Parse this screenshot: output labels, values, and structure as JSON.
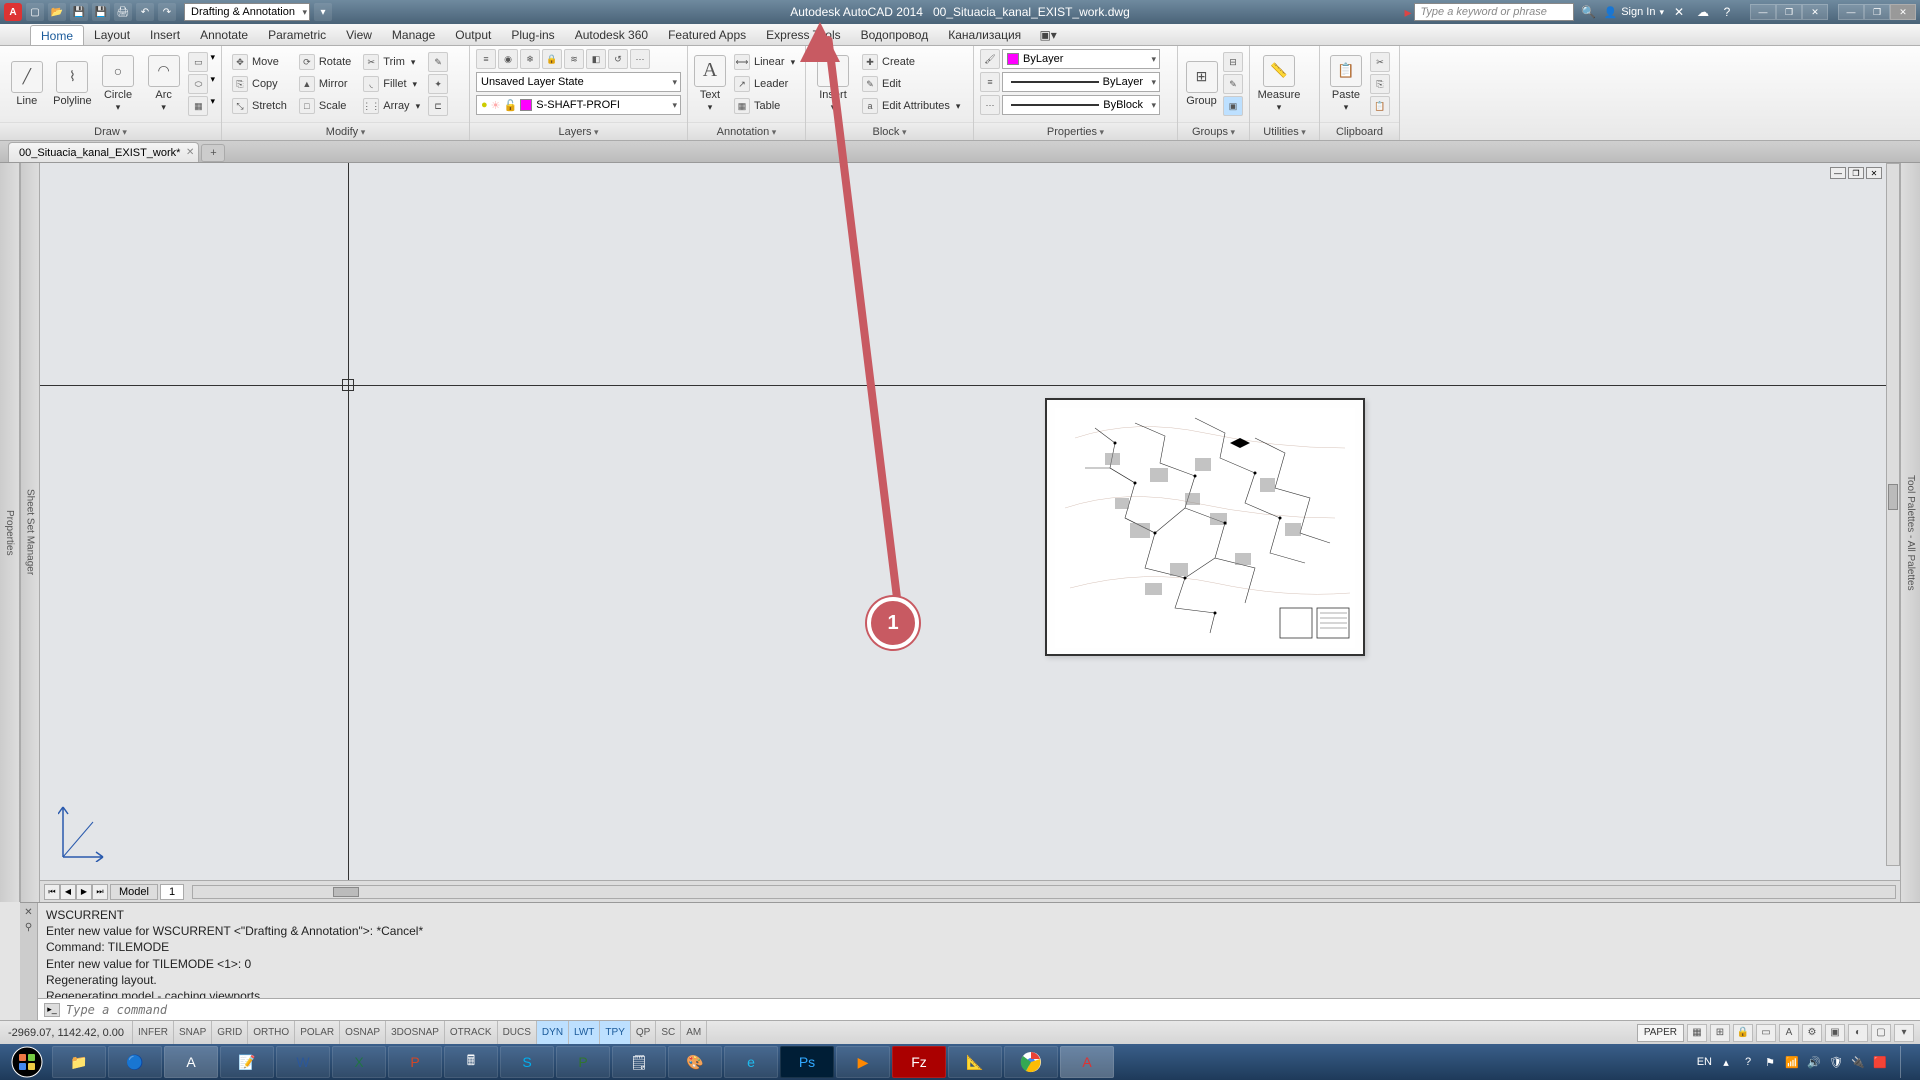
{
  "title": {
    "app": "Autodesk AutoCAD 2014",
    "doc": "00_Situacia_kanal_EXIST_work.dwg"
  },
  "qat": {
    "workspace": "Drafting & Annotation"
  },
  "search": {
    "placeholder": "Type a keyword or phrase"
  },
  "signin": "Sign In",
  "menus": [
    "Home",
    "Layout",
    "Insert",
    "Annotate",
    "Parametric",
    "View",
    "Manage",
    "Output",
    "Plug-ins",
    "Autodesk 360",
    "Featured Apps",
    "Express Tools",
    "Водопровод",
    "Канализация"
  ],
  "ribbon": {
    "draw": {
      "title": "Draw",
      "line": "Line",
      "polyline": "Polyline",
      "circle": "Circle",
      "arc": "Arc"
    },
    "modify": {
      "title": "Modify",
      "move": "Move",
      "rotate": "Rotate",
      "trim": "Trim",
      "copy": "Copy",
      "mirror": "Mirror",
      "fillet": "Fillet",
      "stretch": "Stretch",
      "scale": "Scale",
      "array": "Array"
    },
    "layers": {
      "title": "Layers",
      "state": "Unsaved Layer State",
      "current": "S-SHAFT-PROFI"
    },
    "annotation": {
      "title": "Annotation",
      "text": "Text",
      "linear": "Linear",
      "leader": "Leader",
      "table": "Table"
    },
    "block": {
      "title": "Block",
      "insert": "Insert",
      "create": "Create",
      "edit": "Edit",
      "editattr": "Edit Attributes"
    },
    "properties": {
      "title": "Properties",
      "color": "ByLayer",
      "lw": "ByLayer",
      "lt": "ByBlock"
    },
    "groups": {
      "title": "Groups",
      "group": "Group"
    },
    "utilities": {
      "title": "Utilities",
      "measure": "Measure"
    },
    "clipboard": {
      "title": "Clipboard",
      "paste": "Paste"
    }
  },
  "doctab": {
    "name": "00_Situacia_kanal_EXIST_work*"
  },
  "layout": {
    "model": "Model",
    "l1": "1"
  },
  "cmd": {
    "l1": "WSCURRENT",
    "l2": "Enter new value for WSCURRENT <\"Drafting & Annotation\">: *Cancel*",
    "l3": "Command: TILEMODE",
    "l4": "Enter new value for TILEMODE <1>: 0",
    "l5": "Regenerating layout.",
    "l6": "Regenerating model - caching viewports.",
    "placeholder": "Type a command"
  },
  "status": {
    "coords": "-2969.07, 1142.42, 0.00",
    "toggles": [
      "INFER",
      "SNAP",
      "GRID",
      "ORTHO",
      "POLAR",
      "OSNAP",
      "3DOSNAP",
      "OTRACK",
      "DUCS",
      "DYN",
      "LWT",
      "TPY",
      "QP",
      "SC",
      "AM"
    ],
    "on": [
      "DYN",
      "LWT",
      "TPY"
    ],
    "space": "PAPER"
  },
  "tray": {
    "lang": "EN"
  },
  "annotation_badge": "1"
}
